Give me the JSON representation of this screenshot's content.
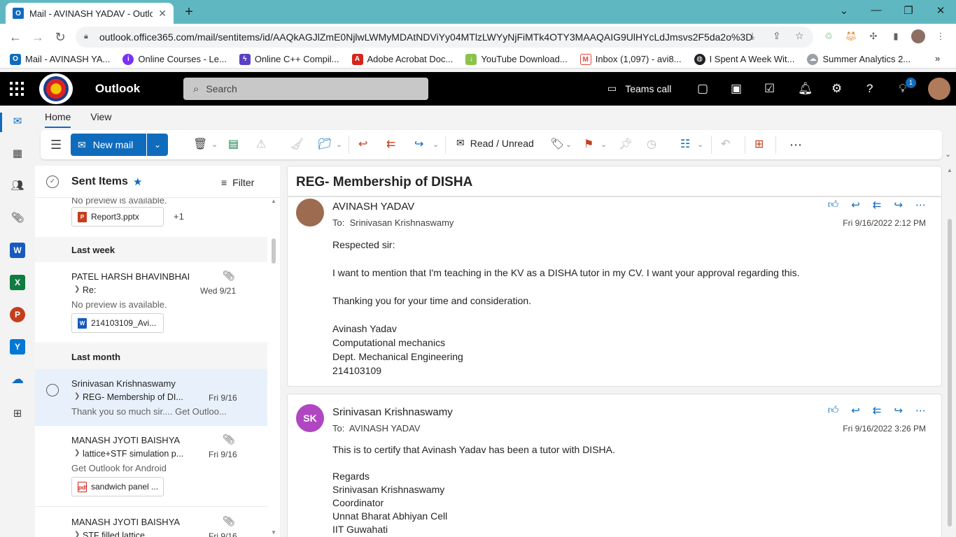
{
  "browser": {
    "tab_title": "Mail - AVINASH YADAV - Outlook",
    "url": "outlook.office365.com/mail/sentitems/id/AAQkAGJlZmE0NjlwLWMyMDAtNDViYy04MTlzLWYyNjFiMTk4OTY3MAAQAIG9UlHYcLdJmsvs2F5da2o%3D",
    "bookmarks": [
      {
        "label": "Mail - AVINASH YA...",
        "icon": "outlook-icon",
        "color": "#0f6cbd"
      },
      {
        "label": "Online Courses - Le...",
        "icon": "course-icon",
        "color": "#7b2ff7"
      },
      {
        "label": "Online C++ Compil...",
        "icon": "bolt-icon",
        "color": "#5b3fc4"
      },
      {
        "label": "Adobe Acrobat Doc...",
        "icon": "acrobat-icon",
        "color": "#d4261c"
      },
      {
        "label": "YouTube Download...",
        "icon": "download-icon",
        "color": "#8bc34a"
      },
      {
        "label": "Inbox (1,097) - avi8...",
        "icon": "gmail-icon",
        "color": "#ea4335"
      },
      {
        "label": "I Spent A Week Wit...",
        "icon": "globe-icon",
        "color": "#202124"
      },
      {
        "label": "Summer Analytics 2...",
        "icon": "cloud-icon",
        "color": "#9aa0a6"
      }
    ]
  },
  "outlook": {
    "app_name": "Outlook",
    "search_placeholder": "Search",
    "teams_call": "Teams call",
    "notification_count": "1",
    "tabs": [
      "Home",
      "View"
    ],
    "new_mail": "New mail",
    "read_unread": "Read / Unread"
  },
  "list": {
    "folder": "Sent Items",
    "filter": "Filter",
    "top_preview": "No preview is available.",
    "top_attachment": "Report3.pptx",
    "top_more": "+1",
    "groups": [
      "Last week",
      "Last month"
    ],
    "items": [
      {
        "sender": "PATEL HARSH BHAVINBHAI",
        "subject": "Re:",
        "date": "Wed 9/21",
        "preview": "No preview is available.",
        "attachment": "214103109_Avi..."
      },
      {
        "sender": "Srinivasan Krishnaswamy",
        "subject": "REG- Membership of DI...",
        "date": "Fri 9/16",
        "preview": "Thank you so much sir.... Get Outloo..."
      },
      {
        "sender": "MANASH JYOTI BAISHYA",
        "subject": "lattice+STF simulation p...",
        "date": "Fri 9/16",
        "preview": "Get Outlook for Android",
        "attachment": "sandwich panel ..."
      },
      {
        "sender": "MANASH JYOTI BAISHYA",
        "subject": "STF filled lattice",
        "date": "Fri 9/16"
      }
    ]
  },
  "reading": {
    "subject": "REG- Membership of DISHA",
    "messages": [
      {
        "from": "AVINASH YADAV",
        "to_label": "To:",
        "to": "Srinivasan Krishnaswamy",
        "when": "Fri 9/16/2022 2:12 PM",
        "body": [
          "Respected sir:",
          "",
          "I want to mention that I'm teaching in the KV as a DISHA tutor in my CV. I want your approval regarding this.",
          "",
          "Thanking you for your time and consideration.",
          "",
          "Avinash Yadav",
          "Computational mechanics",
          "Dept. Mechanical Engineering",
          "214103109"
        ]
      },
      {
        "from": "Srinivasan Krishnaswamy",
        "initials": "SK",
        "to_label": "To:",
        "to": "AVINASH YADAV",
        "when": "Fri 9/16/2022 3:26 PM",
        "body": [
          "This is to certify that Avinash Yadav has been a tutor with DISHA.",
          "",
          "Regards",
          "Srinivasan Krishnaswamy",
          "Coordinator",
          "Unnat Bharat Abhiyan Cell",
          "IIT Guwahati"
        ]
      }
    ]
  },
  "colors": {
    "accent": "#0f6cbd",
    "tabbar": "#5fb8c1",
    "sk_avatar": "#b146c2"
  }
}
